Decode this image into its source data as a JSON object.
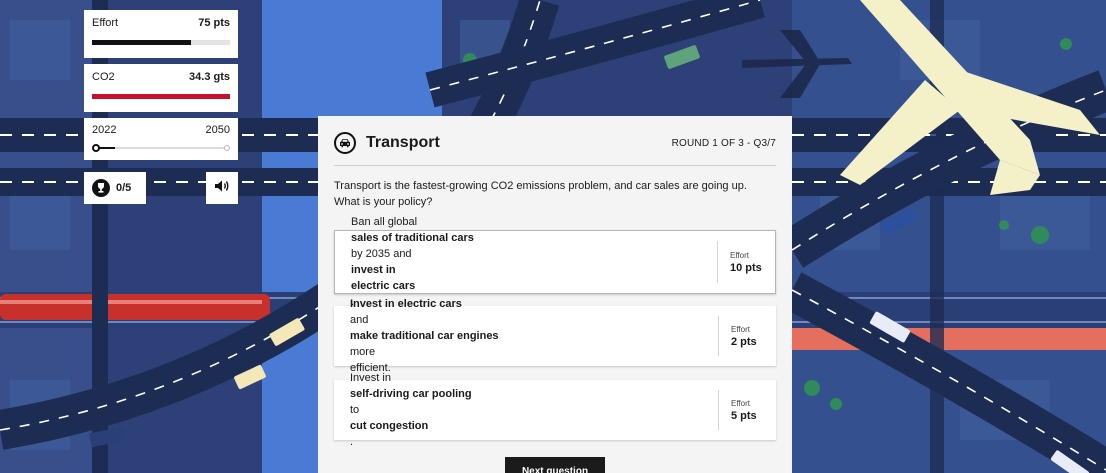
{
  "hud": {
    "effort": {
      "label": "Effort",
      "value": "75 pts",
      "level": 0.72
    },
    "co2": {
      "label": "CO2",
      "value": "34.3 gts",
      "level": 1.0
    },
    "timeline": {
      "start_year": "2022",
      "end_year": "2050",
      "progress": 0.14
    },
    "score": {
      "value": "0/5"
    },
    "icons": {
      "trophy": "trophy-icon",
      "sound": "speaker-icon"
    }
  },
  "question": {
    "topic": "Transport",
    "topic_icon": "car-icon",
    "round": "ROUND 1 OF 3 - Q3/7",
    "prompt": "Transport is the fastest-growing CO2 emissions problem, and car sales are going up. What is your policy?",
    "effort_label": "Effort",
    "options": [
      {
        "line1": [
          "Ban all global ",
          "sales of traditional cars",
          " by 2035 and ",
          "invest in"
        ],
        "line2": [
          "electric cars",
          ".",
          "",
          ""
        ],
        "effort": "10 pts",
        "selected": true
      },
      {
        "line1": [
          "Invest in electric cars",
          " and ",
          "make traditional car engines",
          " more"
        ],
        "line2": [
          "",
          "efficient.",
          "",
          ""
        ],
        "effort": "2 pts",
        "selected": false
      },
      {
        "line1": [
          "",
          "Invest in ",
          "self-driving car pooling",
          " to "
        ],
        "line2": [
          "cut congestion",
          ".",
          "",
          ""
        ],
        "effort": "5 pts",
        "selected": false
      }
    ],
    "next_label": "Next question"
  },
  "colors": {
    "water": "#4a7bd4",
    "road": "#1d2c52",
    "lane_marking": "#ffffff",
    "park": "#2f8b5a",
    "train_red": "#c8312b",
    "plane": "#f4f0c8",
    "co2_bar": "#c8102e"
  }
}
